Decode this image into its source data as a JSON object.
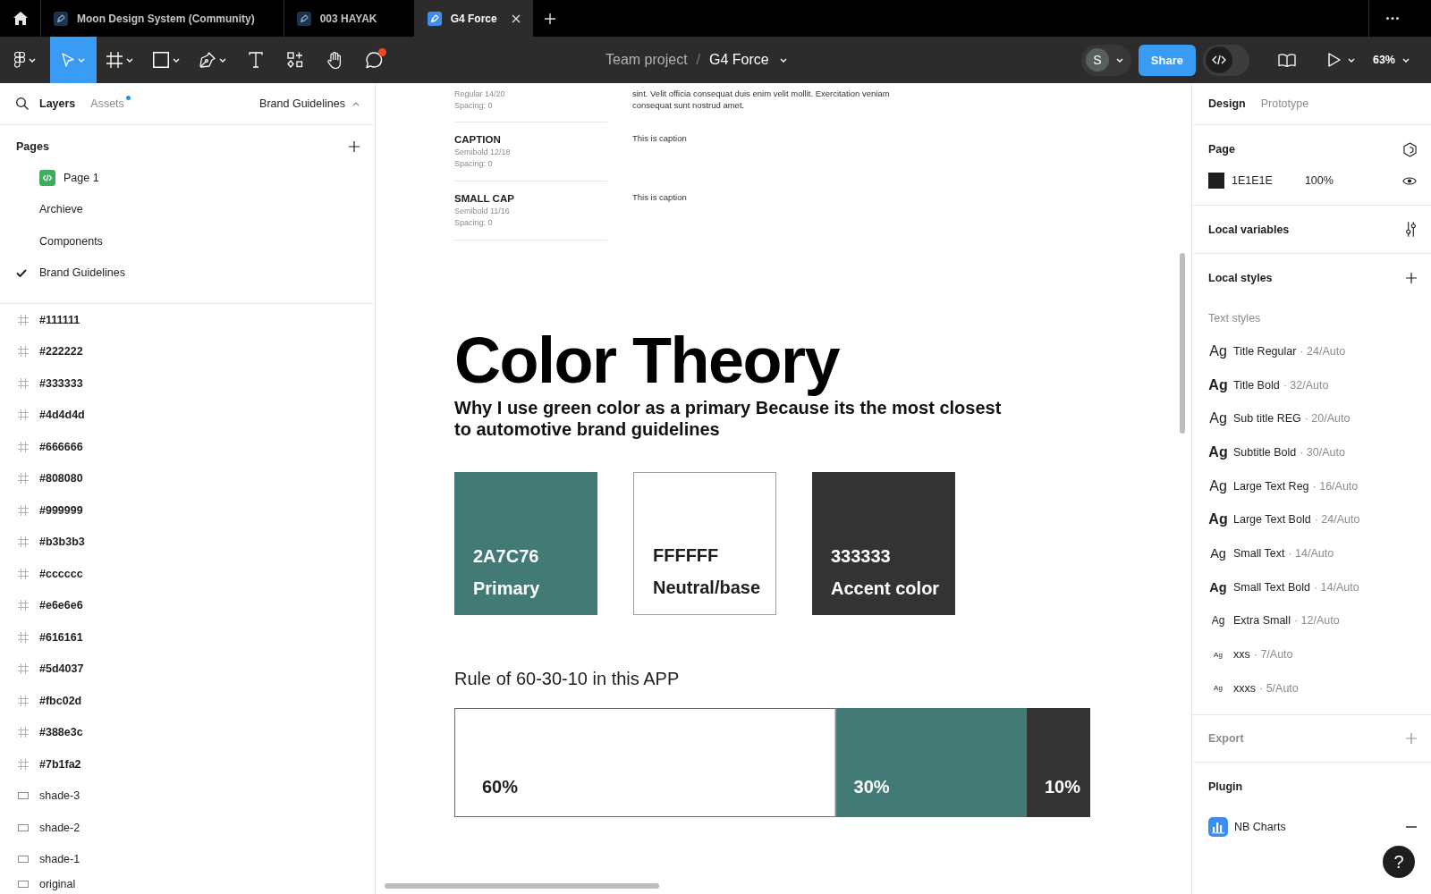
{
  "tab_bar": {
    "tabs": [
      {
        "label": "Moon Design System (Community)",
        "selected": false
      },
      {
        "label": "003 HAYAK",
        "selected": false
      },
      {
        "label": "G4 Force",
        "selected": true
      }
    ]
  },
  "toolbar": {
    "tools": [
      {
        "kind": "main-menu",
        "selected": false,
        "notification": false
      },
      {
        "kind": "move",
        "selected": true,
        "notification": false
      },
      {
        "kind": "frame",
        "selected": false,
        "notification": false
      },
      {
        "kind": "rectangle",
        "selected": false,
        "notification": false
      },
      {
        "kind": "pen",
        "selected": false,
        "notification": false
      },
      {
        "kind": "text",
        "selected": false,
        "notification": false
      },
      {
        "kind": "resources",
        "selected": false,
        "notification": false
      },
      {
        "kind": "hand",
        "selected": false,
        "notification": false
      },
      {
        "kind": "comment",
        "selected": false,
        "notification": true
      }
    ],
    "breadcrumb": {
      "project": "Team project",
      "separator": "/",
      "file": "G4 Force"
    },
    "avatar": {
      "initial": "S"
    },
    "share": "Share",
    "dev_mode": {
      "on": false
    },
    "zoom": "63%"
  },
  "left_panel": {
    "tabs": [
      {
        "label": "Layers",
        "selected": true,
        "badge": false
      },
      {
        "label": "Assets",
        "selected": false,
        "badge": true
      }
    ],
    "page_picker": "Brand Guidelines",
    "pages": {
      "title": "Pages",
      "items": [
        {
          "label": "Page 1",
          "kind": "code",
          "selected": false
        },
        {
          "label": "Archieve",
          "kind": "plain",
          "selected": false
        },
        {
          "label": "Components",
          "kind": "plain",
          "selected": false
        },
        {
          "label": "Brand Guidelines",
          "kind": "plain",
          "selected": true
        }
      ]
    },
    "layers": [
      {
        "label": "#111111",
        "kind": "frame"
      },
      {
        "label": "#222222",
        "kind": "frame"
      },
      {
        "label": "#333333",
        "kind": "frame"
      },
      {
        "label": "#4d4d4d",
        "kind": "frame"
      },
      {
        "label": "#666666",
        "kind": "frame"
      },
      {
        "label": "#808080",
        "kind": "frame"
      },
      {
        "label": "#999999",
        "kind": "frame"
      },
      {
        "label": "#b3b3b3",
        "kind": "frame"
      },
      {
        "label": "#cccccc",
        "kind": "frame"
      },
      {
        "label": "#e6e6e6",
        "kind": "frame"
      },
      {
        "label": "#616161",
        "kind": "frame"
      },
      {
        "label": "#5d4037",
        "kind": "frame"
      },
      {
        "label": "#fbc02d",
        "kind": "frame"
      },
      {
        "label": "#388e3c",
        "kind": "frame"
      },
      {
        "label": "#7b1fa2",
        "kind": "frame"
      },
      {
        "label": "shade-3",
        "kind": "rectangle"
      },
      {
        "label": "shade-2",
        "kind": "rectangle"
      },
      {
        "label": "shade-1",
        "kind": "rectangle"
      },
      {
        "label": "original",
        "kind": "rectangle"
      }
    ]
  },
  "canvas": {
    "type_rows": [
      {
        "spec": "Regular 14/20",
        "spacing": "Spacing: 0",
        "sample_lines": [
          "sint. Velit officia consequat duis enim velit mollit. Exercitation veniam",
          "consequat sunt nostrud amet."
        ]
      },
      {
        "title": "CAPTION",
        "spec": "Semibold 12/18",
        "spacing": "Spacing: 0",
        "sample_lines": [
          "This is caption"
        ]
      },
      {
        "title": "SMALL CAP",
        "spec": "Semibold 11/16",
        "spacing": "Spacing: 0",
        "sample_lines": [
          "This is caption"
        ]
      }
    ],
    "heading": "Color Theory",
    "subtitle_lines": [
      "Why I use green color as a primary Because its the most closest",
      "to automotive brand guidelines"
    ],
    "swatches": [
      {
        "code": "2A7C76",
        "name": "Primary",
        "color": "#427a76"
      },
      {
        "code": "FFFFFF",
        "name": "Neutral/base",
        "color": "#ffffff"
      },
      {
        "code": "333333",
        "name": "Accent color",
        "color": "#333333"
      }
    ],
    "rule": {
      "chart_data": {
        "type": "bar",
        "title": "Rule of 60-30-10 in this APP",
        "orientation": "horizontal",
        "stacked": true,
        "series": [
          {
            "color": "#ffffff",
            "values": [
              60
            ],
            "value_labels": [
              "60%"
            ]
          },
          {
            "color": "#427a76",
            "values": [
              30
            ],
            "value_labels": [
              "30%"
            ]
          },
          {
            "color": "#333333",
            "values": [
              10
            ],
            "value_labels": [
              "10%"
            ]
          }
        ]
      }
    }
  },
  "right_panel": {
    "tabs": [
      {
        "label": "Design",
        "selected": true
      },
      {
        "label": "Prototype",
        "selected": false
      }
    ],
    "page": {
      "title": "Page",
      "fill": {
        "color": "#1e1e1e",
        "hex": "1E1E1E",
        "opacity": "100%"
      }
    },
    "local_variables": {
      "title": "Local variables"
    },
    "local_styles": {
      "title": "Local styles",
      "group": "Text styles",
      "styles": [
        {
          "sample": "Ag",
          "name": "Title Regular",
          "spec": "· 24/Auto",
          "bold": false,
          "kind": "lg"
        },
        {
          "sample": "Ag",
          "name": "Title Bold",
          "spec": "· 32/Auto",
          "bold": true,
          "kind": "lg"
        },
        {
          "sample": "Ag",
          "name": "Sub title REG",
          "spec": "· 20/Auto",
          "bold": false,
          "kind": "lg"
        },
        {
          "sample": "Ag",
          "name": "Subtitle Bold",
          "spec": "· 30/Auto",
          "bold": true,
          "kind": "lg"
        },
        {
          "sample": "Ag",
          "name": "Large Text Reg",
          "spec": "· 16/Auto",
          "bold": false,
          "kind": "lg"
        },
        {
          "sample": "Ag",
          "name": "Large Text Bold",
          "spec": "· 24/Auto",
          "bold": true,
          "kind": "lg"
        },
        {
          "sample": "Ag",
          "name": "Small Text",
          "spec": "· 14/Auto",
          "bold": false,
          "kind": "md"
        },
        {
          "sample": "Ag",
          "name": "Small Text Bold",
          "spec": "· 14/Auto",
          "bold": true,
          "kind": "md"
        },
        {
          "sample": "Ag",
          "name": "Extra Small",
          "spec": "· 12/Auto",
          "bold": false,
          "kind": "sm"
        },
        {
          "sample": "Ag",
          "name": "xxs",
          "spec": "· 7/Auto",
          "bold": false,
          "kind": "xs"
        },
        {
          "sample": "Ag",
          "name": "xxxs",
          "spec": "· 5/Auto",
          "bold": false,
          "kind": "xs"
        }
      ]
    },
    "export": {
      "title": "Export",
      "disabled": true
    },
    "plugins": {
      "title": "Plugin",
      "items": [
        {
          "name": "NB Charts"
        }
      ]
    },
    "help": "?"
  }
}
